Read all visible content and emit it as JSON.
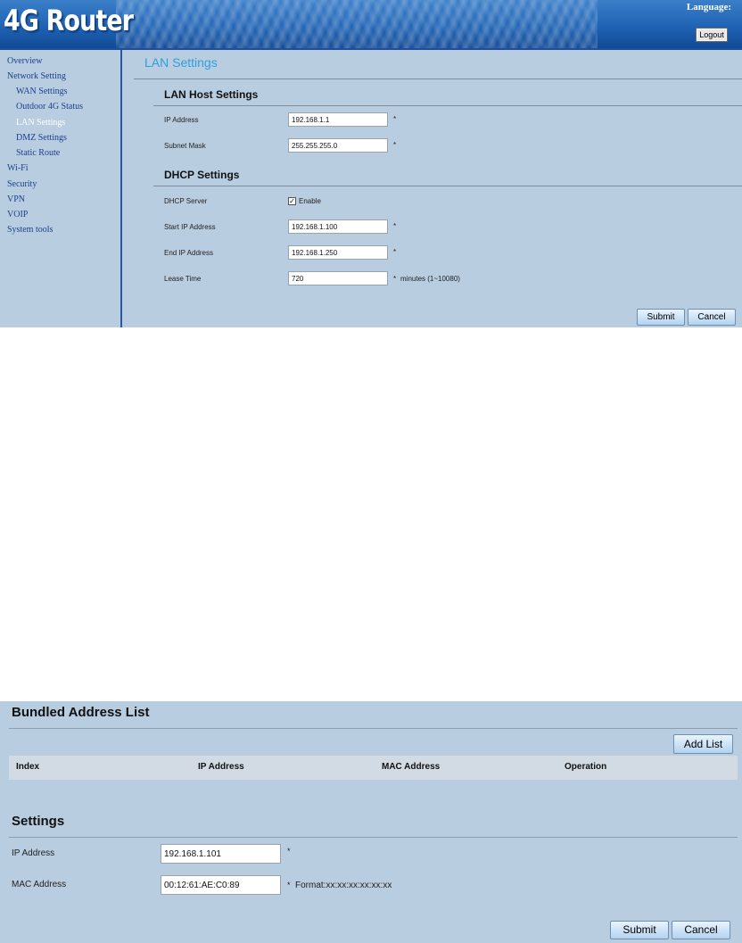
{
  "header": {
    "logo": "4G Router",
    "language_label": "Language:",
    "logout_label": "Logout"
  },
  "sidebar": {
    "items": [
      {
        "label": "Overview",
        "level": 0,
        "active": false
      },
      {
        "label": "Network Setting",
        "level": 0,
        "active": false
      },
      {
        "label": "WAN Settings",
        "level": 1,
        "active": false
      },
      {
        "label": "Outdoor 4G Status",
        "level": 1,
        "active": false
      },
      {
        "label": "LAN Settings",
        "level": 1,
        "active": true
      },
      {
        "label": "DMZ Settings",
        "level": 1,
        "active": false
      },
      {
        "label": "Static Route",
        "level": 1,
        "active": false
      },
      {
        "label": "Wi-Fi",
        "level": 0,
        "active": false
      },
      {
        "label": "Security",
        "level": 0,
        "active": false
      },
      {
        "label": "VPN",
        "level": 0,
        "active": false
      },
      {
        "label": "VOIP",
        "level": 0,
        "active": false
      },
      {
        "label": "System tools",
        "level": 0,
        "active": false
      }
    ]
  },
  "lan": {
    "title": "LAN Settings",
    "host_heading": "LAN Host Settings",
    "ip_label": "IP Address",
    "ip_value": "192.168.1.1",
    "mask_label": "Subnet Mask",
    "mask_value": "255.255.255.0",
    "dhcp_heading": "DHCP Settings",
    "dhcp_server_label": "DHCP Server",
    "dhcp_enable_label": "Enable",
    "dhcp_enabled": true,
    "start_label": "Start IP Address",
    "start_value": "192.168.1.100",
    "end_label": "End IP Address",
    "end_value": "192.168.1.250",
    "lease_label": "Lease Time",
    "lease_value": "720",
    "lease_hint": "minutes (1~10080)",
    "required_mark": "*",
    "submit_label": "Submit",
    "cancel_label": "Cancel"
  },
  "bundled": {
    "heading": "Bundled Address List",
    "add_label": "Add List",
    "columns": [
      "Index",
      "IP Address",
      "MAC Address",
      "Operation"
    ],
    "rows": [],
    "settings_heading": "Settings",
    "ip_label": "IP Address",
    "ip_value": "192.168.1.101",
    "mac_label": "MAC Address",
    "mac_value": "00:12:61:AE:C0:89",
    "mac_hint": "Format:xx:xx:xx:xx:xx:xx",
    "required_mark": "*",
    "submit_label": "Submit",
    "cancel_label": "Cancel"
  }
}
